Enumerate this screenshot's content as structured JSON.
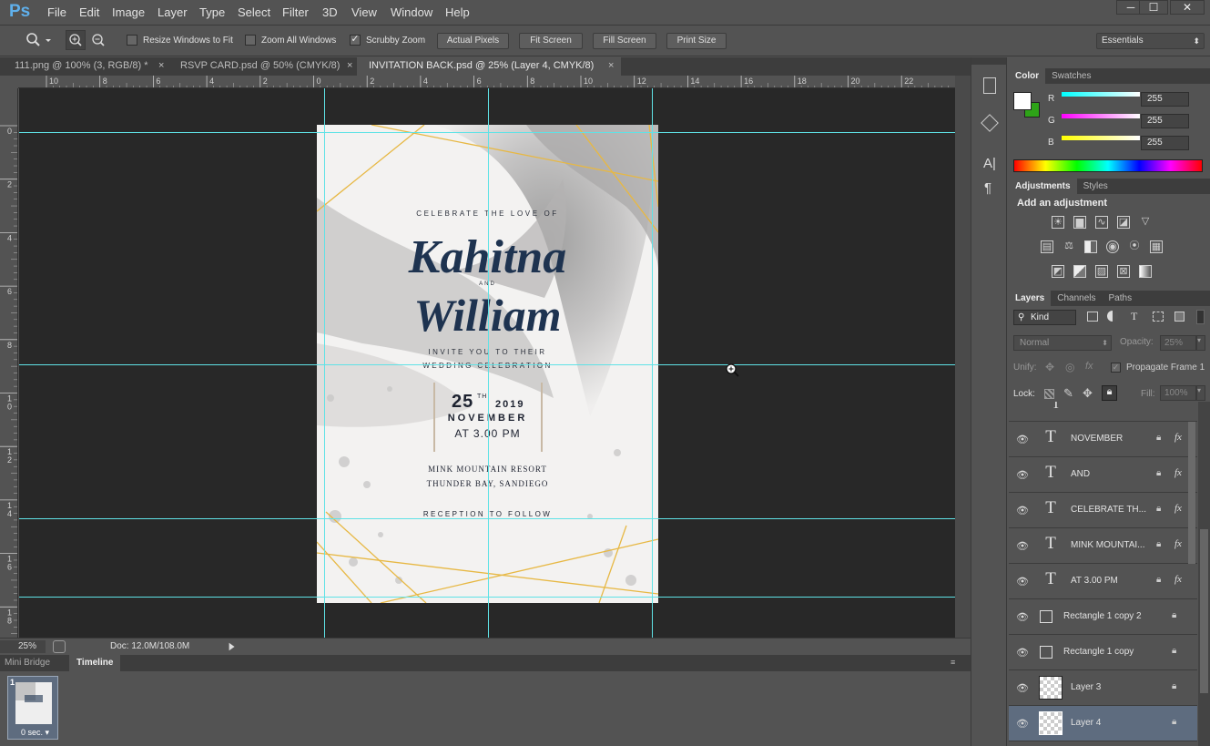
{
  "menu": {
    "logo": "Ps",
    "items": [
      "File",
      "Edit",
      "Image",
      "Layer",
      "Type",
      "Select",
      "Filter",
      "3D",
      "View",
      "Window",
      "Help"
    ],
    "minimize": "─",
    "restore": "☐",
    "close": "✕"
  },
  "options": {
    "resize_windows": "Resize Windows to Fit",
    "zoom_all": "Zoom All Windows",
    "scrubby": "Scrubby Zoom",
    "actual_pixels": "Actual Pixels",
    "fit_screen": "Fit Screen",
    "fill_screen": "Fill Screen",
    "print_size": "Print Size",
    "workspace": "Essentials"
  },
  "tabs": [
    {
      "label": "111.png @ 100% (3, RGB/8) *",
      "close": "×"
    },
    {
      "label": "RSVP CARD.psd @ 50% (CMYK/8)",
      "close": "×"
    },
    {
      "label": "INVITATION BACK.psd @ 25% (Layer 4, CMYK/8)",
      "close": "×"
    }
  ],
  "ruler_top": [
    "10",
    "8",
    "6",
    "4",
    "2",
    "0",
    "2",
    "4",
    "6",
    "8",
    "10",
    "12",
    "14",
    "16",
    "18",
    "20",
    "22"
  ],
  "ruler_left": [
    "0",
    "2",
    "4",
    "6",
    "8",
    "1\n0",
    "1\n2",
    "1\n4",
    "1\n6",
    "1\n8"
  ],
  "invitation": {
    "celebrate": "CELEBRATE THE LOVE OF",
    "name1": "Kahitna",
    "and": "AND",
    "name2": "William",
    "invite1": "INVITE YOU TO THEIR",
    "invite2": "WEDDING CELEBRATION",
    "day": "25",
    "day_suffix": "TH",
    "year": "2019",
    "month": "NOVEMBER",
    "time": "AT 3.00 PM",
    "venue1": "MINK MOUNTAIN RESORT",
    "venue2": "THUNDER BAY, SANDIEGO",
    "reception": "RECEPTION TO FOLLOW"
  },
  "status": {
    "zoom": "25%",
    "doc": "Doc: 12.0M/108.0M"
  },
  "bottom_panel": {
    "tab1": "Mini Bridge",
    "tab2": "Timeline",
    "frame_number": "1",
    "frame_delay": "0 sec. ▾"
  },
  "color_panel": {
    "tab1": "Color",
    "tab2": "Swatches",
    "r_label": "R",
    "r_value": "255",
    "g_label": "G",
    "g_value": "255",
    "b_label": "B",
    "b_value": "255"
  },
  "adjust_panel": {
    "tab1": "Adjustments",
    "tab2": "Styles",
    "heading": "Add an adjustment"
  },
  "layers_panel": {
    "tab1": "Layers",
    "tab2": "Channels",
    "tab3": "Paths",
    "kind": "Kind",
    "blend": "Normal",
    "opacity_label": "Opacity:",
    "opacity_value": "25%",
    "unify_label": "Unify:",
    "propagate": "Propagate Frame 1",
    "lock_label": "Lock:",
    "fill_label": "Fill:",
    "fill_value": "100%",
    "layers": [
      {
        "name": "NOVEMBER",
        "type": "text",
        "fx": true
      },
      {
        "name": "AND",
        "type": "text",
        "fx": true
      },
      {
        "name": "CELEBRATE TH...",
        "type": "text",
        "fx": true
      },
      {
        "name": "MINK MOUNTAI...",
        "type": "text",
        "fx": true
      },
      {
        "name": "AT 3.00 PM",
        "type": "text",
        "fx": true
      },
      {
        "name": "Rectangle 1 copy 2",
        "type": "shape",
        "fx": false
      },
      {
        "name": "Rectangle 1 copy",
        "type": "shape",
        "fx": false
      },
      {
        "name": "Layer 3",
        "type": "pixel",
        "fx": false
      },
      {
        "name": "Layer 4",
        "type": "pixel",
        "fx": false,
        "selected": true
      }
    ]
  },
  "colors": {
    "guide": "#5fe2e6",
    "gold": "#e7b844",
    "navy": "#1e3350",
    "accent_blue": "#5fb0ec"
  }
}
